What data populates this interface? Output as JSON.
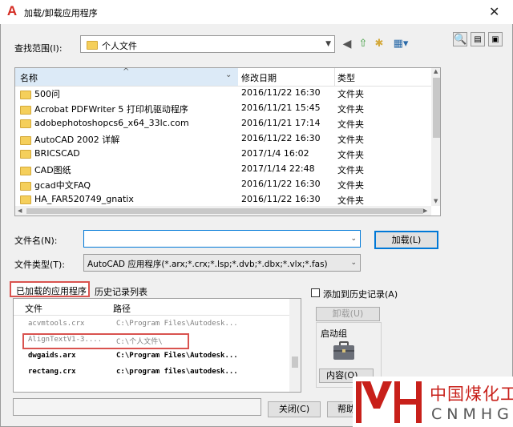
{
  "window": {
    "title": "加载/卸载应用程序",
    "close": "✕"
  },
  "lookin": {
    "label": "查找范围(I):",
    "value": "个人文件"
  },
  "filelist": {
    "headers": {
      "name": "名称",
      "date": "修改日期",
      "type": "类型"
    },
    "rows": [
      {
        "name": "500问",
        "date": "2016/11/22 16:30",
        "type": "文件夹"
      },
      {
        "name": "Acrobat PDFWriter 5 打印机驱动程序",
        "date": "2016/11/21 15:45",
        "type": "文件夹"
      },
      {
        "name": "adobephotoshopcs6_x64_33lc.com",
        "date": "2016/11/21 17:14",
        "type": "文件夹"
      },
      {
        "name": "AutoCAD 2002 详解",
        "date": "2016/11/22 16:30",
        "type": "文件夹"
      },
      {
        "name": "BRICSCAD",
        "date": "2017/1/4 16:02",
        "type": "文件夹"
      },
      {
        "name": "CAD图纸",
        "date": "2017/1/14 22:48",
        "type": "文件夹"
      },
      {
        "name": "gcad中文FAQ",
        "date": "2016/11/22 16:30",
        "type": "文件夹"
      },
      {
        "name": "HA_FAR520749_gnatix",
        "date": "2016/11/22 16:30",
        "type": "文件夹"
      }
    ]
  },
  "filename": {
    "label": "文件名(N):",
    "value": ""
  },
  "filetype": {
    "label": "文件类型(T):",
    "value": "AutoCAD 应用程序(*.arx;*.crx;*.lsp;*.dvb;*.dbx;*.vlx;*.fas)"
  },
  "buttons": {
    "load": "加载(L)",
    "unload": "卸载(U)",
    "contents": "内容(O)...",
    "close": "关闭(C)",
    "help": "帮助"
  },
  "tabs": {
    "loaded": "已加载的应用程序",
    "history": "历史记录列表"
  },
  "add_history": {
    "label": "添加到历史记录(A)"
  },
  "loaded_list": {
    "headers": {
      "file": "文件",
      "path": "路径"
    },
    "rows": [
      {
        "file": "acvmtools.crx",
        "path": "C:\\Program Files\\Autodesk..."
      },
      {
        "file": "AlignTextV1-3....",
        "path": "C:\\个人文件\\"
      },
      {
        "file": "dwgaids.arx",
        "path": "C:\\Program Files\\Autodesk..."
      },
      {
        "file": "rectang.crx",
        "path": "c:\\program files\\autodesk..."
      }
    ]
  },
  "startup": {
    "label": "启动组"
  },
  "status": {
    "value": ""
  },
  "watermark": {
    "cn": "中国煤化工",
    "en": "CNMHG"
  },
  "colors": {
    "accent": "#0078d7",
    "highlight": "#d9534f",
    "logo": "#c8201a"
  }
}
